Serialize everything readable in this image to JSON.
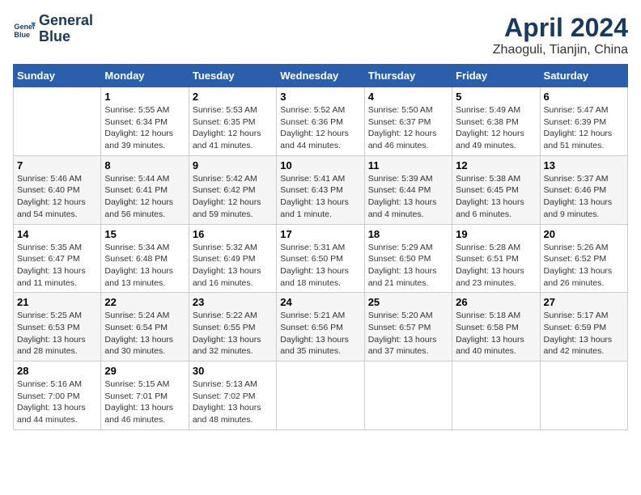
{
  "header": {
    "logo_line1": "General",
    "logo_line2": "Blue",
    "month_year": "April 2024",
    "location": "Zhaoguli, Tianjin, China"
  },
  "days_of_week": [
    "Sunday",
    "Monday",
    "Tuesday",
    "Wednesday",
    "Thursday",
    "Friday",
    "Saturday"
  ],
  "weeks": [
    [
      {
        "day": "",
        "detail": ""
      },
      {
        "day": "1",
        "detail": "Sunrise: 5:55 AM\nSunset: 6:34 PM\nDaylight: 12 hours\nand 39 minutes."
      },
      {
        "day": "2",
        "detail": "Sunrise: 5:53 AM\nSunset: 6:35 PM\nDaylight: 12 hours\nand 41 minutes."
      },
      {
        "day": "3",
        "detail": "Sunrise: 5:52 AM\nSunset: 6:36 PM\nDaylight: 12 hours\nand 44 minutes."
      },
      {
        "day": "4",
        "detail": "Sunrise: 5:50 AM\nSunset: 6:37 PM\nDaylight: 12 hours\nand 46 minutes."
      },
      {
        "day": "5",
        "detail": "Sunrise: 5:49 AM\nSunset: 6:38 PM\nDaylight: 12 hours\nand 49 minutes."
      },
      {
        "day": "6",
        "detail": "Sunrise: 5:47 AM\nSunset: 6:39 PM\nDaylight: 12 hours\nand 51 minutes."
      }
    ],
    [
      {
        "day": "7",
        "detail": "Sunrise: 5:46 AM\nSunset: 6:40 PM\nDaylight: 12 hours\nand 54 minutes."
      },
      {
        "day": "8",
        "detail": "Sunrise: 5:44 AM\nSunset: 6:41 PM\nDaylight: 12 hours\nand 56 minutes."
      },
      {
        "day": "9",
        "detail": "Sunrise: 5:42 AM\nSunset: 6:42 PM\nDaylight: 12 hours\nand 59 minutes."
      },
      {
        "day": "10",
        "detail": "Sunrise: 5:41 AM\nSunset: 6:43 PM\nDaylight: 13 hours\nand 1 minute."
      },
      {
        "day": "11",
        "detail": "Sunrise: 5:39 AM\nSunset: 6:44 PM\nDaylight: 13 hours\nand 4 minutes."
      },
      {
        "day": "12",
        "detail": "Sunrise: 5:38 AM\nSunset: 6:45 PM\nDaylight: 13 hours\nand 6 minutes."
      },
      {
        "day": "13",
        "detail": "Sunrise: 5:37 AM\nSunset: 6:46 PM\nDaylight: 13 hours\nand 9 minutes."
      }
    ],
    [
      {
        "day": "14",
        "detail": "Sunrise: 5:35 AM\nSunset: 6:47 PM\nDaylight: 13 hours\nand 11 minutes."
      },
      {
        "day": "15",
        "detail": "Sunrise: 5:34 AM\nSunset: 6:48 PM\nDaylight: 13 hours\nand 13 minutes."
      },
      {
        "day": "16",
        "detail": "Sunrise: 5:32 AM\nSunset: 6:49 PM\nDaylight: 13 hours\nand 16 minutes."
      },
      {
        "day": "17",
        "detail": "Sunrise: 5:31 AM\nSunset: 6:50 PM\nDaylight: 13 hours\nand 18 minutes."
      },
      {
        "day": "18",
        "detail": "Sunrise: 5:29 AM\nSunset: 6:50 PM\nDaylight: 13 hours\nand 21 minutes."
      },
      {
        "day": "19",
        "detail": "Sunrise: 5:28 AM\nSunset: 6:51 PM\nDaylight: 13 hours\nand 23 minutes."
      },
      {
        "day": "20",
        "detail": "Sunrise: 5:26 AM\nSunset: 6:52 PM\nDaylight: 13 hours\nand 26 minutes."
      }
    ],
    [
      {
        "day": "21",
        "detail": "Sunrise: 5:25 AM\nSunset: 6:53 PM\nDaylight: 13 hours\nand 28 minutes."
      },
      {
        "day": "22",
        "detail": "Sunrise: 5:24 AM\nSunset: 6:54 PM\nDaylight: 13 hours\nand 30 minutes."
      },
      {
        "day": "23",
        "detail": "Sunrise: 5:22 AM\nSunset: 6:55 PM\nDaylight: 13 hours\nand 32 minutes."
      },
      {
        "day": "24",
        "detail": "Sunrise: 5:21 AM\nSunset: 6:56 PM\nDaylight: 13 hours\nand 35 minutes."
      },
      {
        "day": "25",
        "detail": "Sunrise: 5:20 AM\nSunset: 6:57 PM\nDaylight: 13 hours\nand 37 minutes."
      },
      {
        "day": "26",
        "detail": "Sunrise: 5:18 AM\nSunset: 6:58 PM\nDaylight: 13 hours\nand 40 minutes."
      },
      {
        "day": "27",
        "detail": "Sunrise: 5:17 AM\nSunset: 6:59 PM\nDaylight: 13 hours\nand 42 minutes."
      }
    ],
    [
      {
        "day": "28",
        "detail": "Sunrise: 5:16 AM\nSunset: 7:00 PM\nDaylight: 13 hours\nand 44 minutes."
      },
      {
        "day": "29",
        "detail": "Sunrise: 5:15 AM\nSunset: 7:01 PM\nDaylight: 13 hours\nand 46 minutes."
      },
      {
        "day": "30",
        "detail": "Sunrise: 5:13 AM\nSunset: 7:02 PM\nDaylight: 13 hours\nand 48 minutes."
      },
      {
        "day": "",
        "detail": ""
      },
      {
        "day": "",
        "detail": ""
      },
      {
        "day": "",
        "detail": ""
      },
      {
        "day": "",
        "detail": ""
      }
    ]
  ]
}
